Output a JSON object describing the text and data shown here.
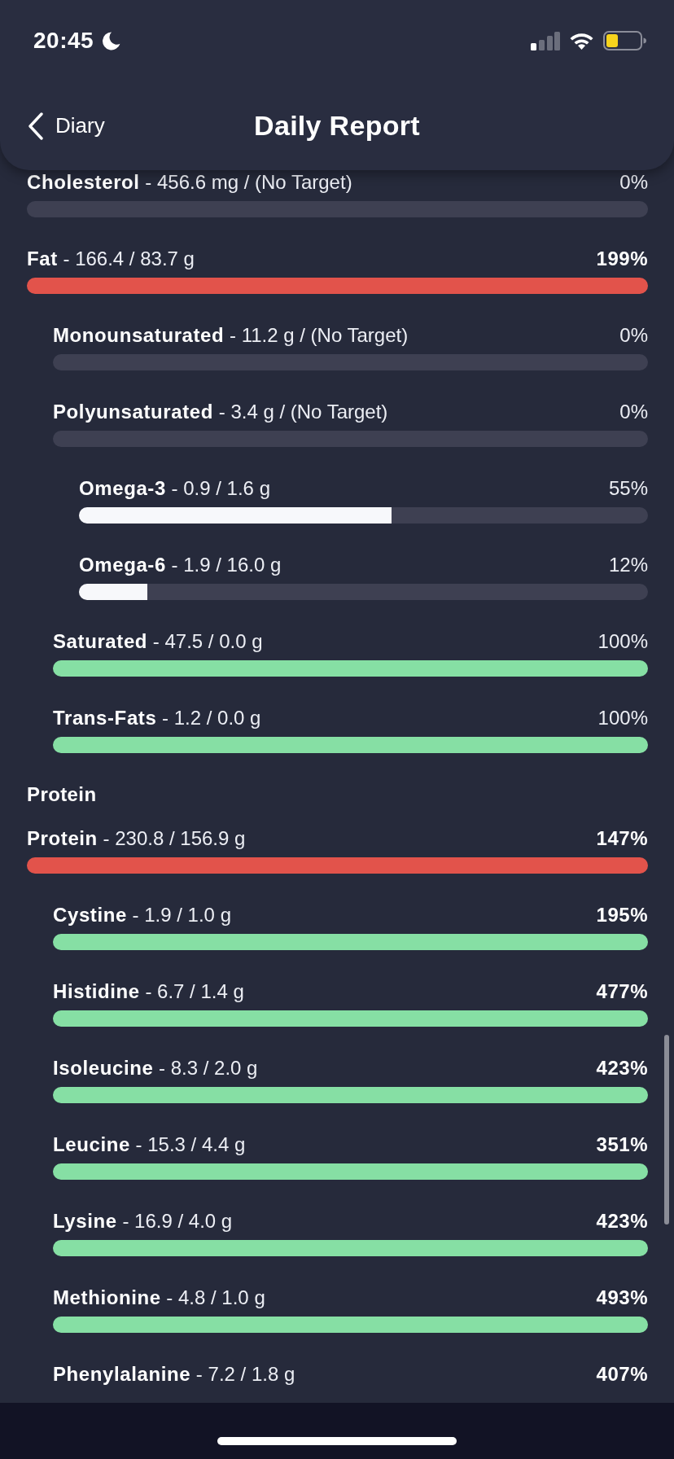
{
  "status_bar": {
    "time": "20:45"
  },
  "header": {
    "back_label": "Diary",
    "title": "Daily Report"
  },
  "sections": [
    {
      "items": [
        {
          "kind": "bar",
          "label": "**Cholesterol** - 456.6 mg / (No Target)",
          "percent": "0%",
          "emphasized": false
        },
        {
          "kind": "bar",
          "label": "**Fat** - 166.4 / 83.7 g",
          "percent": "199%",
          "emphasized": true,
          "level": 1,
          "color": "#e2534b",
          "children": [
            {
              "kind": "bar",
              "label": "**Monounsaturated** - 11.2 g / (No Target)",
              "percent": "0%",
              "emphasized": false
            },
            {
              "kind": "bar",
              "label": "**Polyunsaturated** - 3.4 g / (No Target)",
              "percent": "0%",
              "emphasized": false,
              "children": [
                {
                  "kind": "bar",
                  "label": "**Omega-3** - 0.9 / 1.6 g",
                  "percent": "55%",
                  "emphasized": false,
                  "level": 0.55,
                  "color": "#f7f8fb"
                },
                {
                  "kind": "bar",
                  "label": "**Omega-6** - 1.9 / 16.0 g",
                  "percent": "12%",
                  "emphasized": false,
                  "level": 0.12,
                  "color": "#f7f8fb"
                }
              ]
            },
            {
              "kind": "bar",
              "label": "**Saturated** - 47.5 / 0.0 g",
              "percent": "100%",
              "emphasized": false,
              "level": 1,
              "color": "#86dfa4"
            },
            {
              "kind": "bar",
              "label": "**Trans-Fats** - 1.2 / 0.0 g",
              "percent": "100%",
              "emphasized": false,
              "level": 1,
              "color": "#86dfa4"
            }
          ]
        }
      ]
    },
    {
      "heading": "Protein",
      "items": [
        {
          "kind": "bar",
          "label": "**Protein** - 230.8 / 156.9 g",
          "percent": "147%",
          "emphasized": true,
          "level": 1,
          "color": "#e2534b",
          "children": [
            {
              "kind": "bar",
              "label": "**Cystine** - 1.9 / 1.0 g",
              "percent": "195%",
              "emphasized": true,
              "level": 1,
              "color": "#86dfa4"
            },
            {
              "kind": "bar",
              "label": "**Histidine** - 6.7 / 1.4 g",
              "percent": "477%",
              "emphasized": true,
              "level": 1,
              "color": "#86dfa4"
            },
            {
              "kind": "bar",
              "label": "**Isoleucine** - 8.3 / 2.0 g",
              "percent": "423%",
              "emphasized": true,
              "level": 1,
              "color": "#86dfa4"
            },
            {
              "kind": "bar",
              "label": "**Leucine** - 15.3 / 4.4 g",
              "percent": "351%",
              "emphasized": true,
              "level": 1,
              "color": "#86dfa4"
            },
            {
              "kind": "bar",
              "label": "**Lysine** - 16.9 / 4.0 g",
              "percent": "423%",
              "emphasized": true,
              "level": 1,
              "color": "#86dfa4"
            },
            {
              "kind": "bar",
              "label": "**Methionine** - 4.8 / 1.0 g",
              "percent": "493%",
              "emphasized": true,
              "level": 1,
              "color": "#86dfa4"
            },
            {
              "kind": "label",
              "label": "**Phenylalanine** - 7.2 / 1.8 g",
              "percent": "407%",
              "emphasized": true
            }
          ]
        }
      ]
    }
  ]
}
